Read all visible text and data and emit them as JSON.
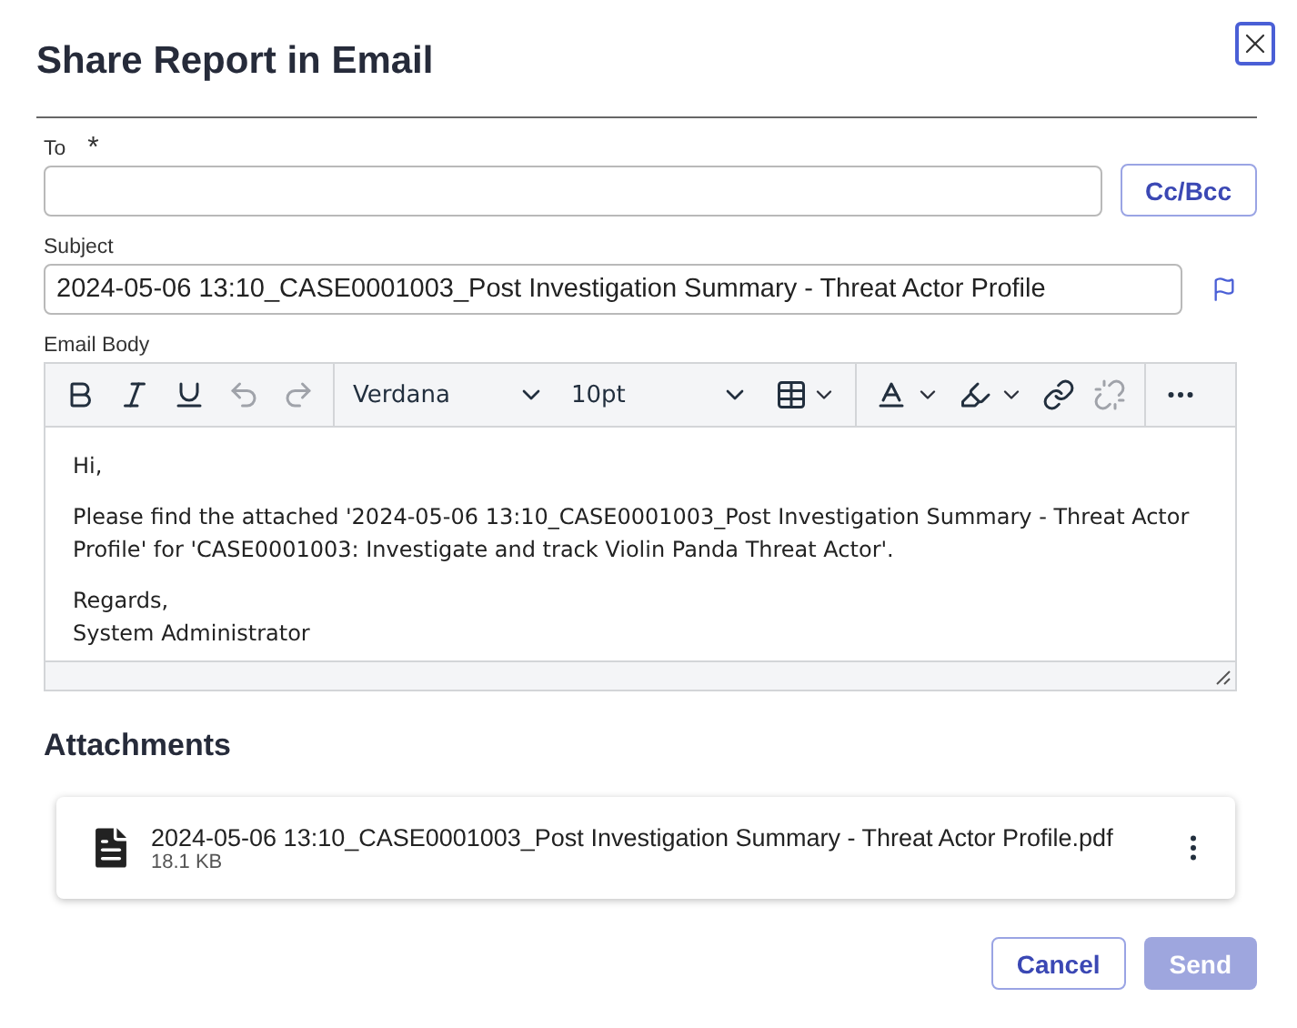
{
  "dialog": {
    "title": "Share Report in Email"
  },
  "to": {
    "label": "To",
    "required_mark": "*",
    "cc_bcc_button": "Cc/Bcc"
  },
  "subject": {
    "label": "Subject",
    "value": "2024-05-06 13:10_CASE0001003_Post Investigation Summary - Threat Actor Profile"
  },
  "email_body": {
    "label": "Email Body",
    "toolbar": {
      "tools": [
        {
          "kind": "bold",
          "disabled": false
        },
        {
          "kind": "italic",
          "disabled": false
        },
        {
          "kind": "underline",
          "disabled": false
        },
        {
          "kind": "undo",
          "disabled": true
        },
        {
          "kind": "redo",
          "disabled": true
        }
      ],
      "font": "Verdana",
      "font_size": "10pt",
      "format_tools": [
        {
          "kind": "text-color",
          "disabled": false
        },
        {
          "kind": "highlight",
          "disabled": false
        },
        {
          "kind": "link",
          "disabled": false
        },
        {
          "kind": "unlink",
          "disabled": true
        }
      ]
    },
    "paragraphs": [
      [
        "Hi,"
      ],
      [
        "Please find the attached '2024-05-06 13:10_CASE0001003_Post Investigation Summary - Threat Actor Profile' for 'CASE0001003: Investigate and track Violin Panda Threat Actor'."
      ],
      [
        "Regards,",
        "System Administrator"
      ]
    ]
  },
  "attachments": {
    "heading": "Attachments",
    "files": [
      {
        "name": "2024-05-06 13:10_CASE0001003_Post Investigation Summary - Threat Actor Profile.pdf",
        "size": "18.1 KB"
      }
    ]
  },
  "buttons": [
    {
      "label": "Cancel",
      "kind": "secondary",
      "disabled": false
    },
    {
      "label": "Send",
      "kind": "primary",
      "disabled": true
    }
  ]
}
